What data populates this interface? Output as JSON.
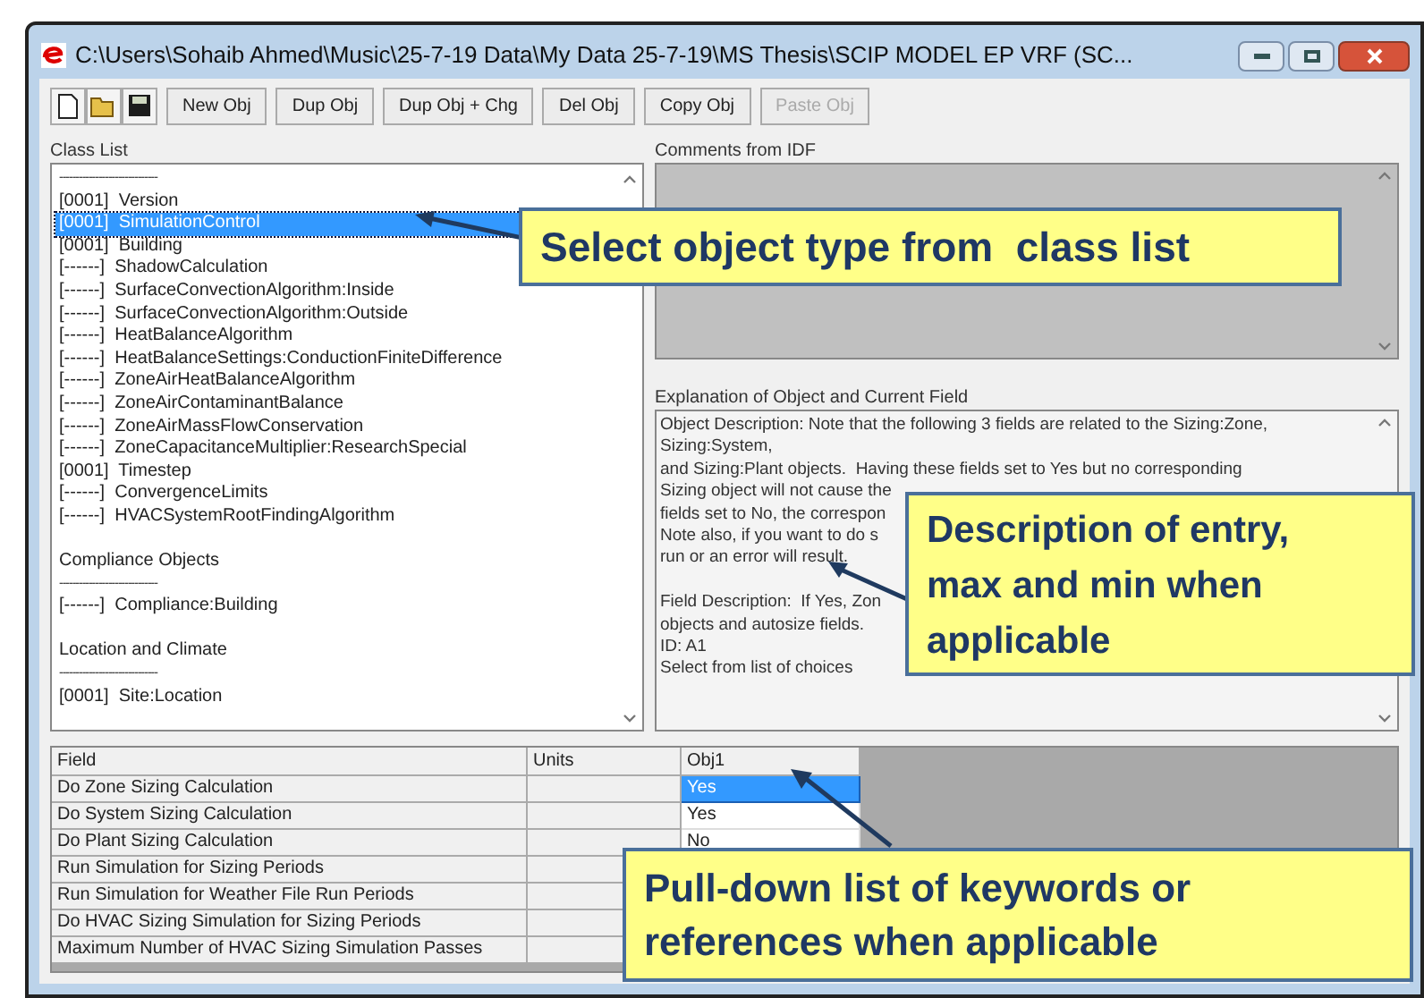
{
  "window": {
    "title": "C:\\Users\\Sohaib Ahmed\\Music\\25-7-19 Data\\My Data 25-7-19\\MS Thesis\\SCIP MODEL EP VRF (SC..."
  },
  "toolbar": {
    "buttons": [
      {
        "label": "New Obj",
        "disabled": false
      },
      {
        "label": "Dup Obj",
        "disabled": false
      },
      {
        "label": "Dup Obj + Chg",
        "disabled": false
      },
      {
        "label": "Del Obj",
        "disabled": false
      },
      {
        "label": "Copy Obj",
        "disabled": false
      },
      {
        "label": "Paste Obj",
        "disabled": true
      }
    ]
  },
  "class_list": {
    "label": "Class List",
    "items": [
      {
        "kind": "separator",
        "text": "------------------------------"
      },
      {
        "kind": "item",
        "text": "[0001]  Version",
        "selected": false
      },
      {
        "kind": "item",
        "text": "[0001]  SimulationControl",
        "selected": true
      },
      {
        "kind": "item",
        "text": "[0001]  Building",
        "selected": false
      },
      {
        "kind": "item",
        "text": "[------]  ShadowCalculation",
        "selected": false
      },
      {
        "kind": "item",
        "text": "[------]  SurfaceConvectionAlgorithm:Inside",
        "selected": false
      },
      {
        "kind": "item",
        "text": "[------]  SurfaceConvectionAlgorithm:Outside",
        "selected": false
      },
      {
        "kind": "item",
        "text": "[------]  HeatBalanceAlgorithm",
        "selected": false
      },
      {
        "kind": "item",
        "text": "[------]  HeatBalanceSettings:ConductionFiniteDifference",
        "selected": false
      },
      {
        "kind": "item",
        "text": "[------]  ZoneAirHeatBalanceAlgorithm",
        "selected": false
      },
      {
        "kind": "item",
        "text": "[------]  ZoneAirContaminantBalance",
        "selected": false
      },
      {
        "kind": "item",
        "text": "[------]  ZoneAirMassFlowConservation",
        "selected": false
      },
      {
        "kind": "item",
        "text": "[------]  ZoneCapacitanceMultiplier:ResearchSpecial",
        "selected": false
      },
      {
        "kind": "item",
        "text": "[0001]  Timestep",
        "selected": false
      },
      {
        "kind": "item",
        "text": "[------]  ConvergenceLimits",
        "selected": false
      },
      {
        "kind": "item",
        "text": "[------]  HVACSystemRootFindingAlgorithm",
        "selected": false
      },
      {
        "kind": "blank"
      },
      {
        "kind": "group",
        "text": "Compliance Objects"
      },
      {
        "kind": "separator",
        "text": "------------------------------"
      },
      {
        "kind": "item",
        "text": "[------]  Compliance:Building",
        "selected": false
      },
      {
        "kind": "blank"
      },
      {
        "kind": "group",
        "text": "Location and Climate"
      },
      {
        "kind": "separator",
        "text": "------------------------------"
      },
      {
        "kind": "item",
        "text": "[0001]  Site:Location",
        "selected": false
      }
    ]
  },
  "comments": {
    "label": "Comments from IDF"
  },
  "explanation": {
    "label": "Explanation of Object and Current Field",
    "object_lines": [
      "Object Description: Note that the following 3 fields are related to the Sizing:Zone,",
      "Sizing:System,",
      "and Sizing:Plant objects.  Having these fields set to Yes but no corresponding",
      "Sizing object will not cause the",
      "fields set to No, the correspon",
      "Note also, if you want to do s",
      "run or an error will result."
    ],
    "field_lines": [
      "Field Description:  If Yes, Zon",
      "objects and autosize fields.",
      "ID: A1",
      "Select from list of choices"
    ]
  },
  "grid": {
    "columns": [
      "Field",
      "Units",
      "Obj1"
    ],
    "rows": [
      {
        "field": "Do Zone Sizing Calculation",
        "value": "Yes",
        "selected": true
      },
      {
        "field": "Do System Sizing Calculation",
        "value": "Yes",
        "selected": false
      },
      {
        "field": "Do Plant Sizing Calculation",
        "value": "No",
        "selected": false
      },
      {
        "field": "Run Simulation for Sizing Periods"
      },
      {
        "field": "Run Simulation for Weather File Run Periods"
      },
      {
        "field": "Do HVAC Sizing Simulation for Sizing Periods"
      },
      {
        "field": "Maximum Number of HVAC Sizing Simulation Passes"
      }
    ]
  },
  "callouts": [
    "Select object type from  class list",
    "Description of entry, max and min when applicable",
    "Pull-down list of keywords or references when applicable"
  ]
}
